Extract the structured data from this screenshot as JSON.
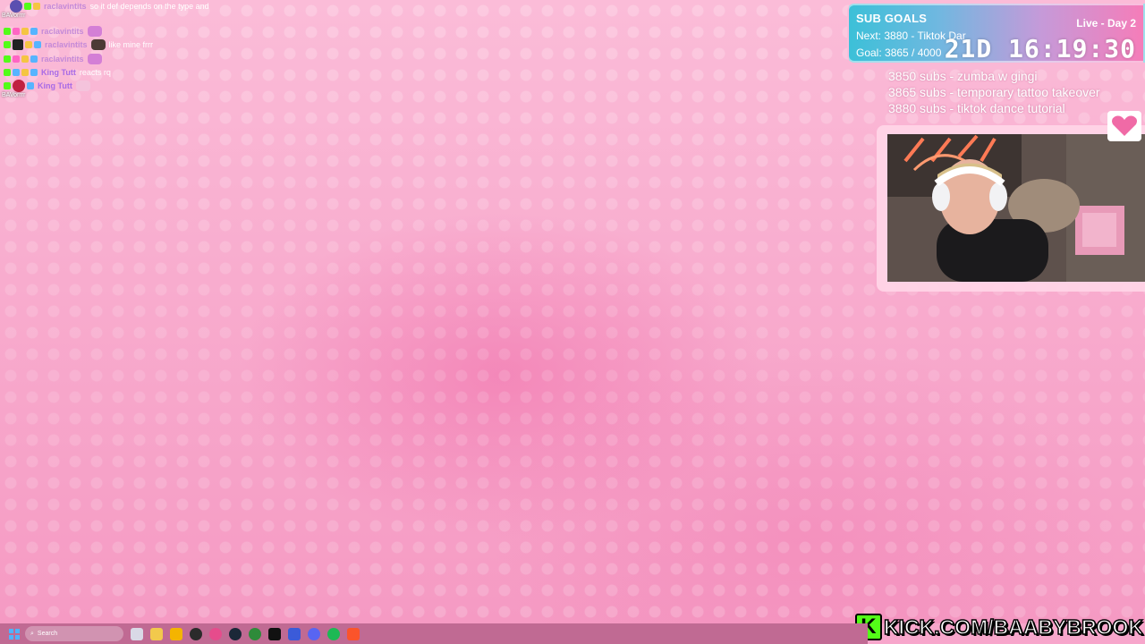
{
  "chat": {
    "messages": [
      {
        "user": "raclavintits",
        "message": "so it def depends on the type and"
      },
      {
        "user": "raclavintits",
        "message": ""
      },
      {
        "user": "raclavintits",
        "message": "like mine frrr"
      },
      {
        "user": "raclavintits",
        "message": ""
      },
      {
        "user": "King Tutt",
        "message": "reacts rq"
      },
      {
        "user": "King Tutt",
        "message": ""
      }
    ],
    "side_labels": [
      "BAVorrrr",
      "BAVorrrr"
    ]
  },
  "sub_goals": {
    "title": "SUB GOALS",
    "next": "Next: 3880 - Tiktok Dar",
    "goal": "Goal: 3865 / 4000",
    "live": "Live - Day 2",
    "timer": "21D 16:19:30"
  },
  "goal_list": [
    "3850 subs - zumba w gingi",
    "3865 subs - temporary tattoo takeover",
    "3880 subs - tiktok dance tutorial"
  ],
  "kick": {
    "logo": "K",
    "url": "KICK.COM/BAABYBROOK"
  },
  "taskbar": {
    "search_placeholder": "Search",
    "icons": [
      "start-icon",
      "taskview-icon",
      "widgets-icon",
      "file-explorer-icon",
      "obs-icon",
      "app-icon",
      "steam-icon",
      "xbox-icon",
      "tiktok-icon",
      "streamer-app-icon",
      "discord-icon",
      "spotify-icon",
      "brave-icon"
    ]
  },
  "colors": {
    "kick_green": "#53fc18",
    "taskbar": "#c06a93",
    "background_pink": "#f8acce"
  }
}
